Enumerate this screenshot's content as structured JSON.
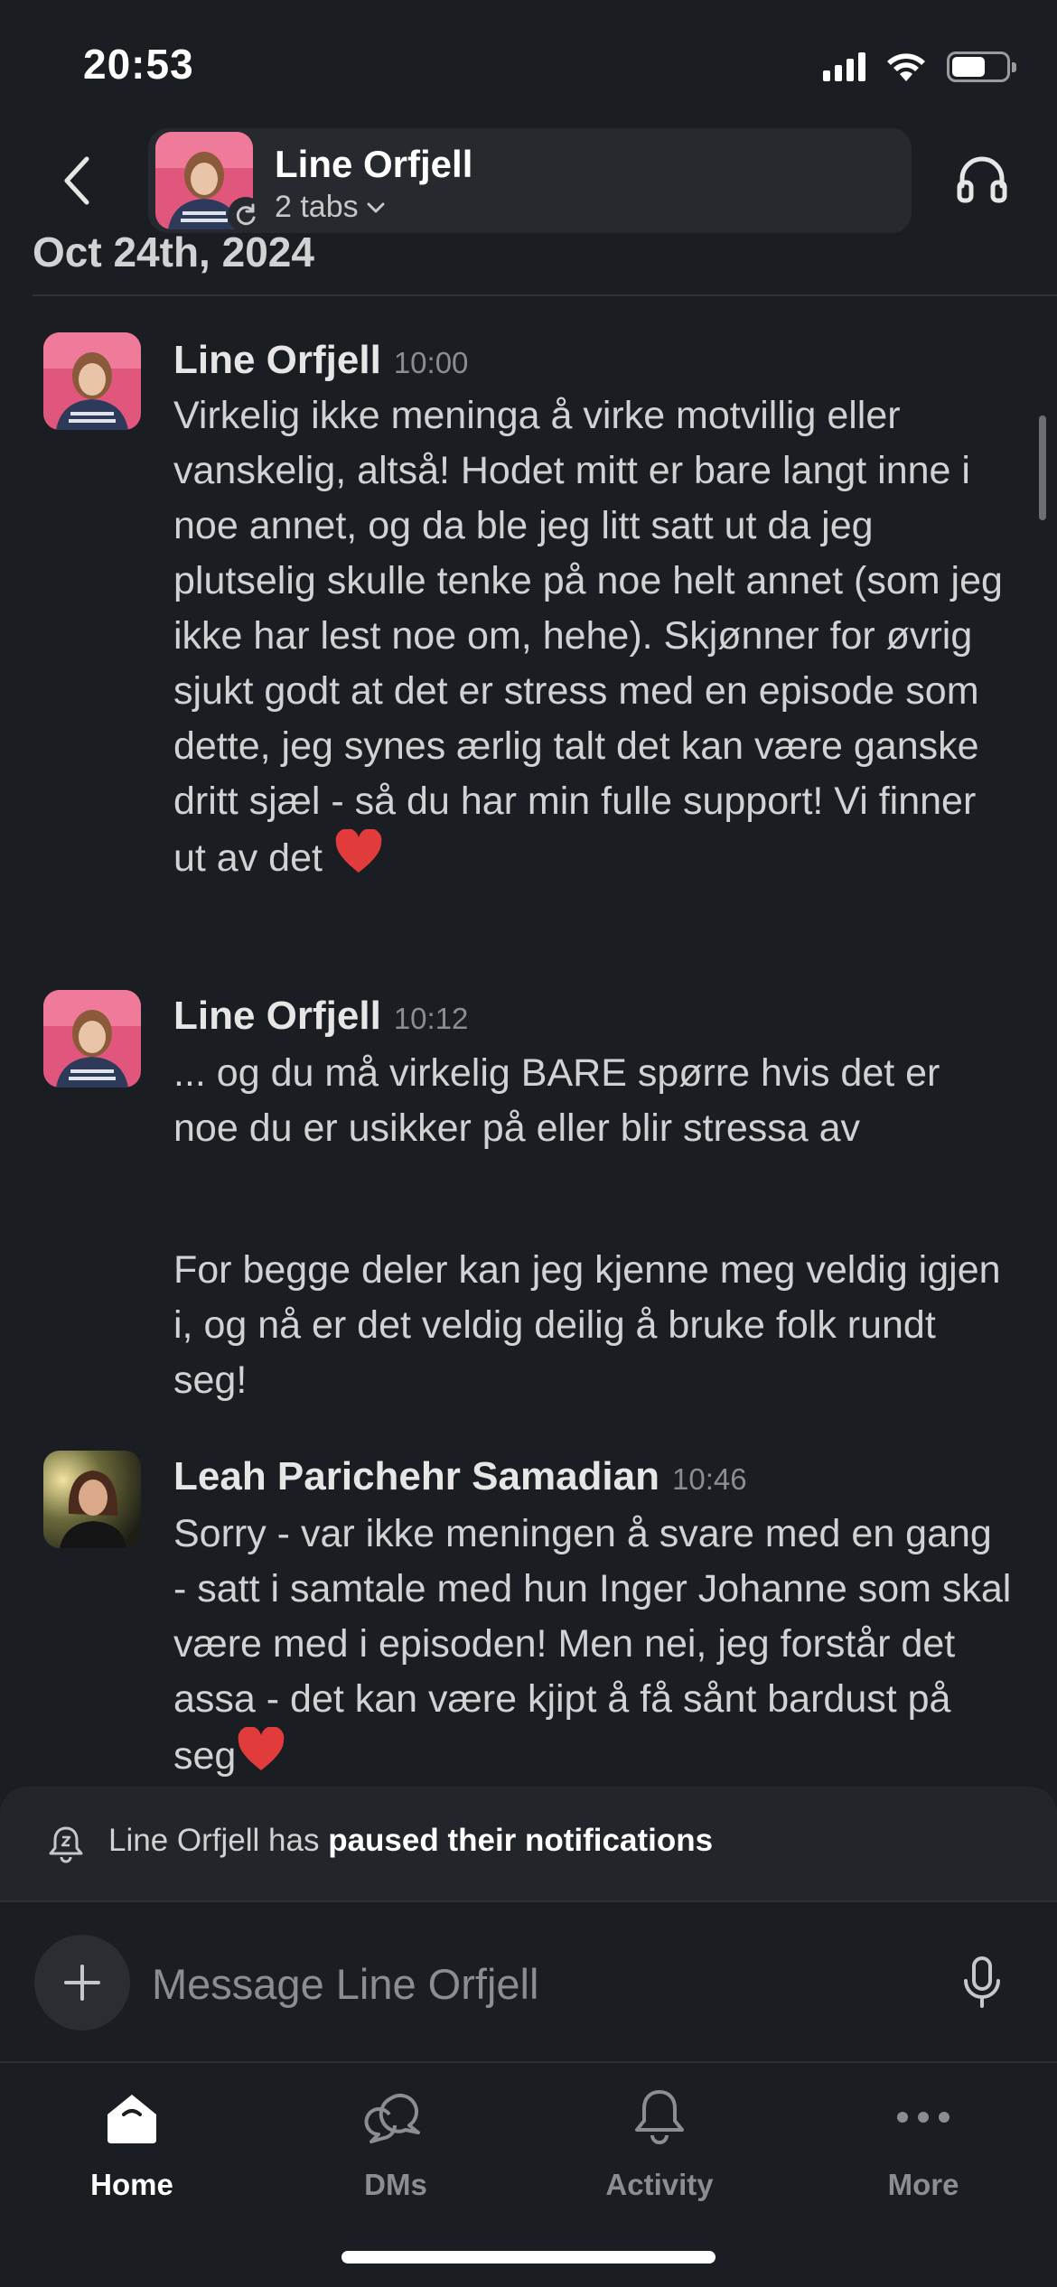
{
  "status_bar": {
    "time": "20:53"
  },
  "header": {
    "name": "Line Orfjell",
    "subtitle": "2 tabs"
  },
  "date_divider": "Oct 24th, 2024",
  "messages": [
    {
      "author": "Line Orfjell",
      "time": "10:00",
      "text": "Virkelig ikke meninga å virke motvillig eller vanskelig, altså! Hodet mitt er bare langt inne i noe annet, og da ble jeg litt satt ut da jeg plutselig skulle tenke på noe helt annet (som jeg ikke har lest noe om, hehe). Skjønner for øvrig sjukt godt at det er stress med en episode som dette, jeg synes ærlig talt det kan være ganske dritt sjæl - så du har min fulle support! Vi finner ut av det",
      "emoji": "heart"
    },
    {
      "author": "Line Orfjell",
      "time": "10:12",
      "text": "... og du må virkelig BARE spørre hvis det er noe du er usikker på eller blir stressa av",
      "text2": "For begge deler kan jeg kjenne meg veldig igjen i, og nå er det veldig deilig å bruke folk rundt seg!"
    },
    {
      "author": "Leah Parichehr Samadian",
      "time": "10:46",
      "text": "Sorry - var ikke meningen å svare med en gang - satt i samtale med hun Inger Johanne som skal være med i episoden! Men nei, jeg forstår det assa - det kan være kjipt å få sånt bardust på seg",
      "emoji": "heart"
    }
  ],
  "paused_banner": {
    "prefix": "Line Orfjell has",
    "bold": "paused their notifications",
    "icon": "bell-snooze-icon"
  },
  "composer": {
    "placeholder": "Message Line Orfjell"
  },
  "tabs": [
    {
      "label": "Home",
      "icon": "home-icon",
      "active": true
    },
    {
      "label": "DMs",
      "icon": "dms-icon",
      "active": false
    },
    {
      "label": "Activity",
      "icon": "bell-icon",
      "active": false
    },
    {
      "label": "More",
      "icon": "more-icon",
      "active": false
    }
  ],
  "colors": {
    "background": "#1a1d21",
    "text": "#d1d2d3",
    "muted": "#8b8d90",
    "heart": "#e23b3b"
  }
}
